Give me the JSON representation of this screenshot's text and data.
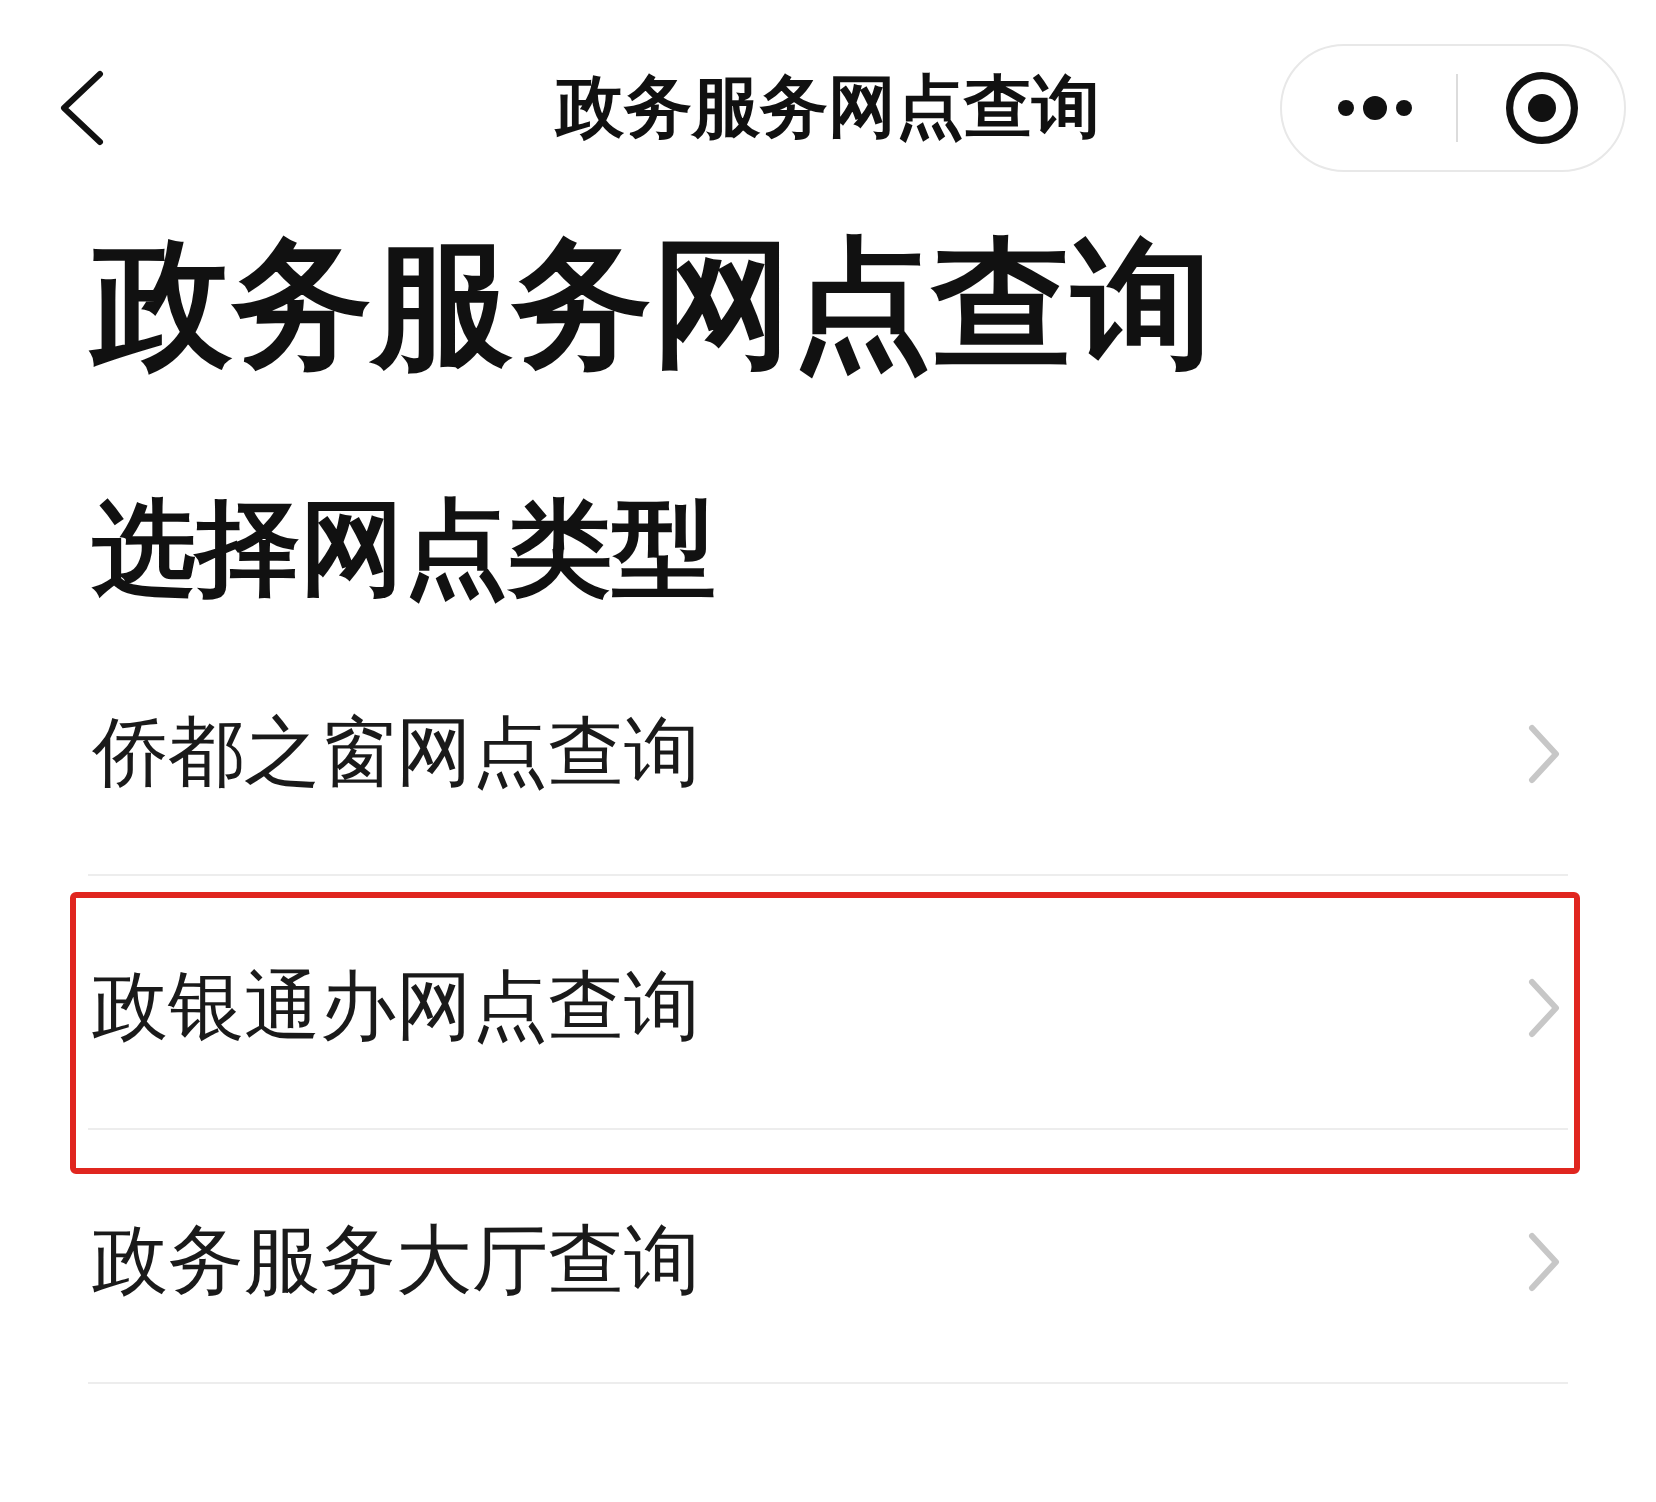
{
  "nav_bar": {
    "title": "政务服务网点查询"
  },
  "page_title": "政务服务网点查询",
  "section_title": "选择网点类型",
  "options": [
    {
      "label": "侨都之窗网点查询",
      "highlighted": false
    },
    {
      "label": "政银通办网点查询",
      "highlighted": true
    },
    {
      "label": "政务服务大厅查询",
      "highlighted": false
    }
  ]
}
